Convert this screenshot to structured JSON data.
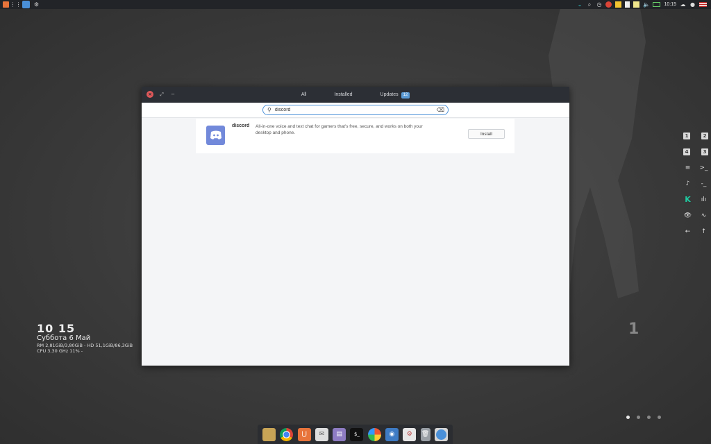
{
  "top_panel": {
    "left_icons": [
      "app-menu-icon",
      "apps-grid-icon",
      "browser-icon",
      "settings-icon"
    ],
    "right_icons": [
      "chevron-down-icon",
      "search-icon",
      "history-icon",
      "chrome-icon",
      "note-icon",
      "clipboard-icon",
      "paint-icon",
      "volume-icon",
      "battery-icon"
    ],
    "clock": "10:15",
    "tray_icons": [
      "cloud-icon",
      "user-icon",
      "us-flag-icon"
    ]
  },
  "window": {
    "tabs": [
      {
        "label": "All"
      },
      {
        "label": "Installed"
      },
      {
        "label": "Updates",
        "badge": "12"
      }
    ],
    "search": {
      "value": "discord"
    },
    "result": {
      "name": "discord",
      "description": "All-in-one voice and text chat for gamers that's free, secure, and works on both your desktop and phone.",
      "action": "Install"
    }
  },
  "conky": {
    "time": "10 15",
    "date": "Суббота  6 Май",
    "mem": "RM 2,81GiB/3,80GiB - HD 51,1GiB/86,3GiB",
    "cpu": "CPU 3,30 GHz 11% -"
  },
  "right_widgets": [
    [
      "1",
      "2"
    ],
    [
      "4",
      "3"
    ],
    [
      "≡",
      ">_"
    ],
    [
      "♪",
      "-_"
    ],
    [
      "K",
      "ılı"
    ],
    [
      "👁",
      "∿"
    ],
    [
      "←",
      "↑"
    ]
  ],
  "workspace_number": "1",
  "dock": {
    "apps": [
      "files-icon",
      "chrome-icon",
      "ubuntu-store-icon",
      "mail-icon",
      "notes-icon",
      "terminal-icon",
      "photos-icon",
      "camera-icon",
      "settings-toggle-icon",
      "trash-icon",
      "browser-icon"
    ]
  }
}
